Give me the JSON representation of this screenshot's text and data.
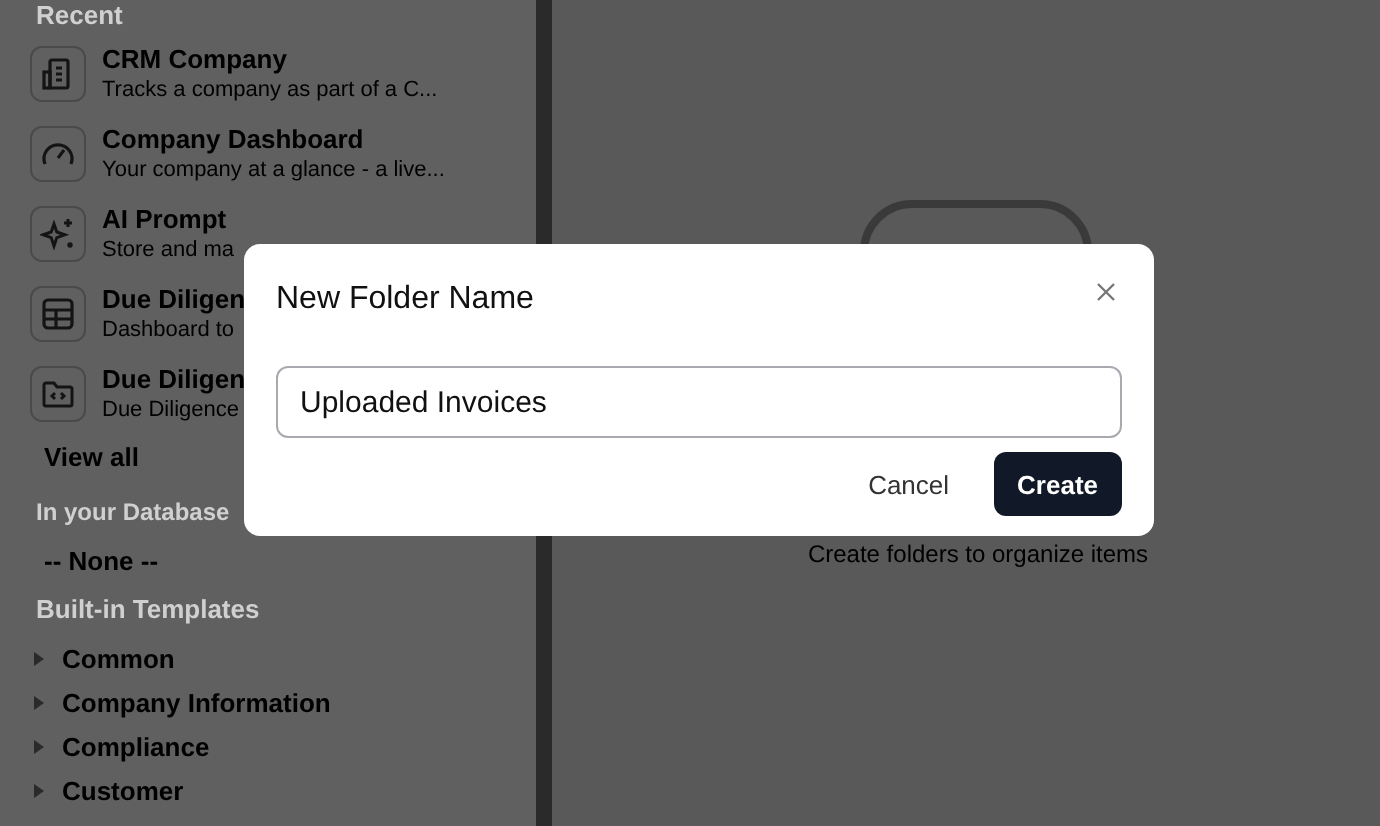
{
  "sidebar": {
    "recent_heading": "Recent",
    "recent": [
      {
        "title": "CRM Company",
        "description": "Tracks a company as part of a C..."
      },
      {
        "title": "Company Dashboard",
        "description": "Your company at a glance - a live..."
      },
      {
        "title": "AI Prompt",
        "description": "Store and ma"
      },
      {
        "title": "Due Diligen",
        "description": "Dashboard to"
      },
      {
        "title": "Due Diligen",
        "description": "Due Diligence"
      }
    ],
    "view_all": "View all",
    "database_heading": "In your Database",
    "database_empty": "-- None --",
    "templates_heading": "Built-in Templates",
    "templates": [
      {
        "label": "Common",
        "expanded": false
      },
      {
        "label": "Company Information",
        "expanded": false
      },
      {
        "label": "Compliance",
        "expanded": false
      },
      {
        "label": "Customer",
        "expanded": false
      }
    ]
  },
  "main": {
    "empty_text": "Create folders to organize items"
  },
  "dialog": {
    "title": "New Folder Name",
    "value": "Uploaded Invoices",
    "buttons": [
      {
        "label": "Cancel",
        "kind": "secondary"
      },
      {
        "label": "Create",
        "kind": "primary"
      }
    ]
  }
}
